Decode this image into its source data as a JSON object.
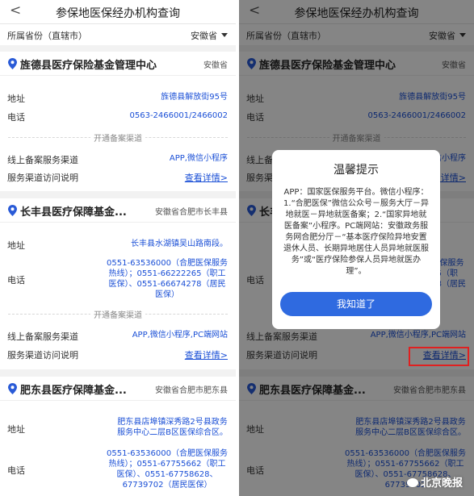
{
  "header": {
    "back": "<",
    "title": "参保地医保经办机构查询"
  },
  "province": {
    "label": "所属省份（直辖市）",
    "value": "安徽省"
  },
  "labels": {
    "address": "地址",
    "phone": "电话",
    "separator": "开通备案渠道",
    "online_channel": "线上备案服务渠道",
    "access_guide": "服务渠道访问说明",
    "detail_link": "查看详情>"
  },
  "cards": [
    {
      "name": "旌德县医疗保险基金管理中心",
      "region": "安徽省",
      "address": "旌德县解放街95号",
      "phone": [
        "0563-2466001/2466002"
      ],
      "channel": "APP,微信小程序"
    },
    {
      "name": "长丰县医疗保障基金...",
      "region": "安徽省合肥市长丰县",
      "address": "长丰县水湖镇吴山路南段。",
      "phone": [
        "0551-63536000（合肥医保服务",
        "热线）；0551-66222265（职工",
        "医保）、0551-66674278（居民",
        "医保）"
      ],
      "channel": "APP,微信小程序,PC端网站"
    },
    {
      "name": "肥东县医疗保障基金...",
      "region": "安徽省合肥市肥东县",
      "address": [
        "肥东县店埠镇深秀路2号县政务",
        "服务中心二层B区医保综合区。"
      ],
      "phone": [
        "0551-63536000（合肥医保服务",
        "热线）；0551-67755662（职工",
        "医保）、0551-67758628、",
        "67739702（居民医保）"
      ]
    }
  ],
  "modal": {
    "title": "温馨提示",
    "body": "APP：国家医保服务平台。微信小程序：1.“合肥医保”微信公众号－服务大厅－异地就医－异地就医备案；2.“国家异地就医备案”小程序。PC端网站：安徽政务服务网合肥分厅－“基本医疗保险异地安置退休人员、长期异地居住人员异地就医服务”或“医疗保险参保人员异地就医办理”。",
    "button": "我知道了"
  },
  "right_phone_partial": [
    "0551-63536000（合肥医保服务",
    "热线）；0551-66222265（职",
    "工医保）、0551-66674278（居民",
    "医保）"
  ],
  "right_phone3_partial": [
    "0551-63536000（合肥医保服务",
    "热线）；0551-67755662（职工",
    "医保）、0551-67758628、",
    "67739702"
  ],
  "watermark": "北京晚报",
  "colors": {
    "link": "#1a4fd6",
    "button": "#2f6ae0",
    "highlight": "#e02020",
    "pin": "#2a5bd7"
  }
}
